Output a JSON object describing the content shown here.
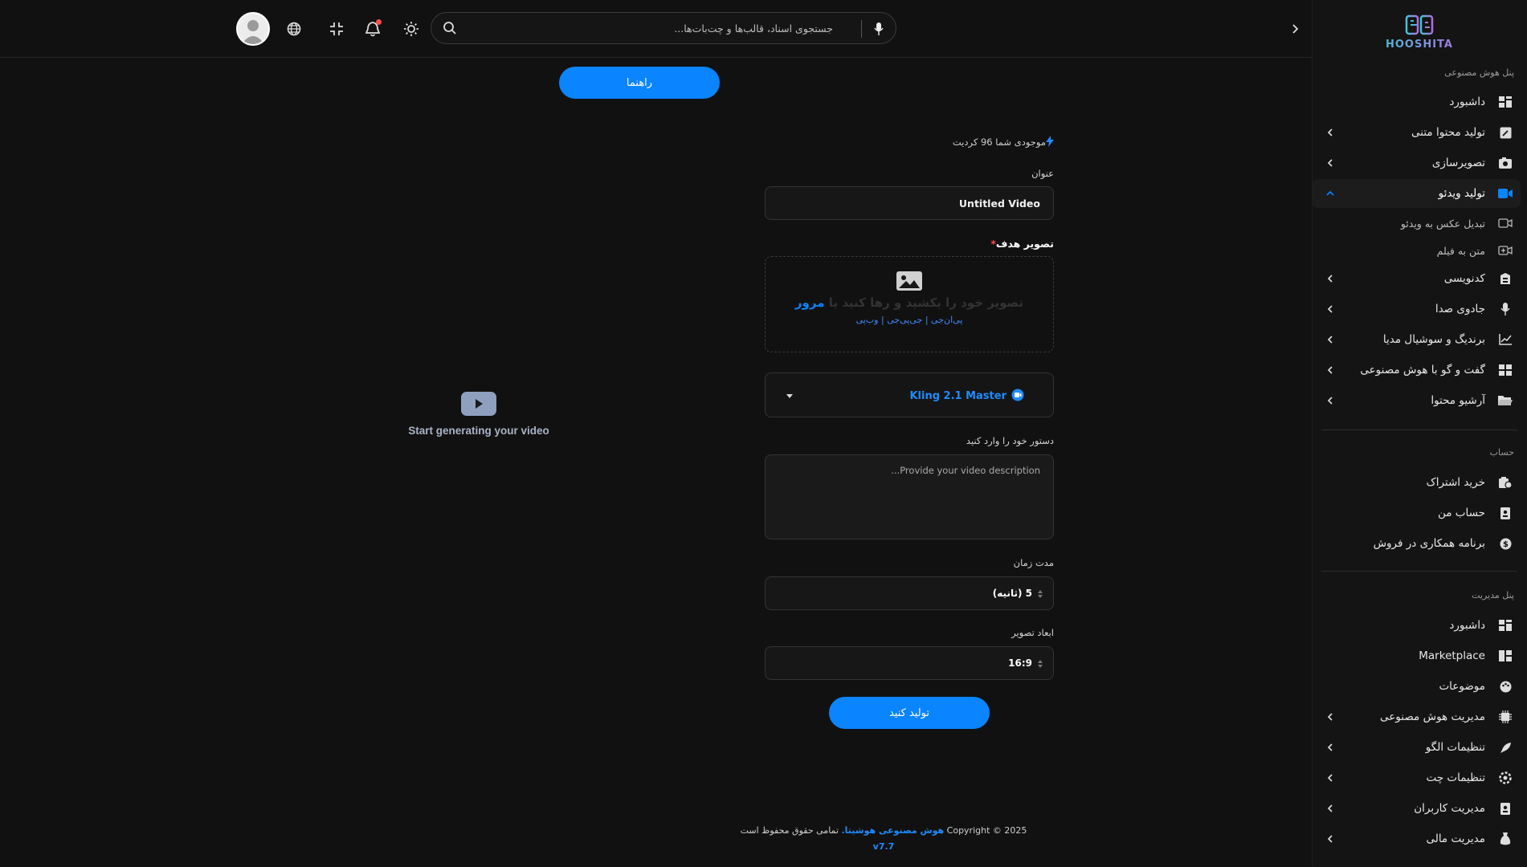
{
  "app": {
    "logo_text": "HOOSHITA"
  },
  "colors": {
    "accent": "#0a84ff",
    "background": "#111111",
    "sidebar": "#141414",
    "danger": "#ff4d4f"
  },
  "sidebar": {
    "section_ai": "پنل هوش مصنوعی",
    "items_ai": [
      {
        "label": "داشبورد",
        "icon": "dashboard-icon",
        "chevron": false
      },
      {
        "label": "تولید محتوا متنی",
        "icon": "edit-icon",
        "chevron": true
      },
      {
        "label": "تصویرسازی",
        "icon": "camera-icon",
        "chevron": true
      },
      {
        "label": "تولید ویدئو",
        "icon": "video-icon",
        "chevron": true,
        "active": true
      },
      {
        "label": "کدنویسی",
        "icon": "code-icon",
        "chevron": true
      },
      {
        "label": "جادوی صدا",
        "icon": "mic-icon",
        "chevron": true
      },
      {
        "label": "برندیگ و سوشیال مدیا",
        "icon": "chart-icon",
        "chevron": true
      },
      {
        "label": "گفت و گو با هوش مصنوعی",
        "icon": "chat-icon",
        "chevron": true
      },
      {
        "label": "آرشیو محتوا",
        "icon": "folder-icon",
        "chevron": true
      }
    ],
    "sub_items": [
      {
        "label": "تبدیل عکس به ویدئو",
        "icon": "video-outline-icon"
      },
      {
        "label": "متن به فیلم",
        "icon": "video-plus-icon"
      }
    ],
    "section_account": "حساب",
    "items_account": [
      {
        "label": "خرید اشتراک",
        "icon": "subscription-icon"
      },
      {
        "label": "حساب من",
        "icon": "id-card-icon"
      },
      {
        "label": "برنامه همکاری در فروش",
        "icon": "dollar-icon"
      }
    ],
    "section_admin": "پنل مدیریت",
    "items_admin": [
      {
        "label": "داشبورد",
        "icon": "dashboard-icon",
        "chevron": false
      },
      {
        "label": "Marketplace",
        "icon": "marketplace-icon",
        "chevron": false
      },
      {
        "label": "موضوعات",
        "icon": "palette-icon",
        "chevron": false
      },
      {
        "label": "مدیریت هوش مصنوعی",
        "icon": "chip-icon",
        "chevron": true
      },
      {
        "label": "تنظیمات الگو",
        "icon": "feather-icon",
        "chevron": true
      },
      {
        "label": "تنظیمات چت",
        "icon": "settings-gear-icon",
        "chevron": true
      },
      {
        "label": "مدیریت کاربران",
        "icon": "users-icon",
        "chevron": true
      },
      {
        "label": "مدیریت مالی",
        "icon": "money-icon",
        "chevron": true
      }
    ]
  },
  "topbar": {
    "search_placeholder": "جستجوی اسناد، قالب‌ها و چت‌بات‌ها...",
    "icons": [
      "sun-icon",
      "bell-icon",
      "fullscreen-icon",
      "globe-icon"
    ]
  },
  "main": {
    "guide_button": "راهنما",
    "credit_text": "موجودی شما 96 کردیت",
    "title_label": "عنوان",
    "title_value": "Untitled Video",
    "image_label": "تصویر هدف",
    "required_mark": "*",
    "drop_text": "تصویر خود را بکشید و رها کنید یا",
    "drop_browse": "مرور",
    "drop_formats": "پی‌ان‌جی | جی‌پی‌جی | وب‌پی",
    "model_name": "Kling 2.1 Master",
    "prompt_label": "دستور خود را وارد کنید",
    "prompt_placeholder": "Provide your video description...",
    "duration_label": "مدت زمان",
    "duration_value": "5 (ثانیه)",
    "ratio_label": "ابعاد تصویر",
    "ratio_value": "16:9",
    "generate_button": "تولید کنید",
    "preview_text": "Start generating your video"
  },
  "footer": {
    "copyright": "Copyright © 2025",
    "brand": "هوش مصنوعی هوشیتا.",
    "rights": "تمامی حقوق محفوظ است",
    "version": "v7.7"
  }
}
